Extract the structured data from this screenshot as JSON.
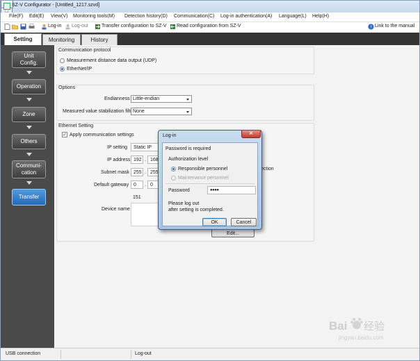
{
  "window": {
    "title": "SZ-V Configurator - [Untitled_1217.szvd]",
    "min": "—",
    "max": "□",
    "close": "✕"
  },
  "menu": [
    {
      "label": "File(F)"
    },
    {
      "label": "Edit(E)"
    },
    {
      "label": "View(V)"
    },
    {
      "label": "Monitoring tools(M)"
    },
    {
      "label": "Detection history(D)"
    },
    {
      "label": "Communication(C)"
    },
    {
      "label": "Log-in authentication(A)"
    },
    {
      "label": "Language(L)"
    },
    {
      "label": "Help(H)"
    }
  ],
  "toolbar": {
    "login": "Log-in",
    "logout": "Log-out",
    "transfer": "Transfer configuration to SZ-V",
    "read": "Read configuration from SZ-V",
    "manual": "Link to the manual"
  },
  "tabs": [
    {
      "label": "Setting"
    },
    {
      "label": "Monitoring"
    },
    {
      "label": "History"
    }
  ],
  "nav": [
    {
      "label": "Unit\nConfig."
    },
    {
      "label": "Operation"
    },
    {
      "label": "Zone"
    },
    {
      "label": "Others"
    },
    {
      "label": "Communi-\ncation"
    },
    {
      "label": "Transfer"
    }
  ],
  "comm_protocol": {
    "title": "Communication protocol",
    "opt_udp": "Measurement distance data output (UDP)",
    "opt_eip": "EtherNet/IP"
  },
  "options": {
    "title": "Options",
    "endianness_label": "Endianness",
    "endianness_value": "Little-endian",
    "stab_label": "Measured value stabilization filter",
    "stab_value": "None"
  },
  "ethernet": {
    "title": "Ethernet Setting",
    "apply_label": "Apply communication settings",
    "ip_setting_label": "IP setting",
    "ip_setting_value": "Static IP",
    "ip_address_label": "IP address",
    "ip_o1": "192",
    "ip_o2": "168",
    "subnet_label": "Subnet mask",
    "sub_o1": "255",
    "sub_o2": "255",
    "gateway_label": "Default gateway",
    "gw_o1": "0",
    "gw_o2": "0",
    "dot": ".",
    "extra_number": "151",
    "right_partial": "ection",
    "device_name_label": "Device name",
    "edit_button": "Edit..."
  },
  "dialog": {
    "title": "Log-in",
    "close": "✕",
    "pw_required": "Password is required",
    "auth_level": "Authorization level",
    "responsible": "Responsible personnel",
    "maintenance": "Maintenance personnel",
    "password_label": "Password",
    "password_value": "●●●●",
    "note_line1": "Please log out",
    "note_line2": "after setting is completed.",
    "ok": "OK",
    "cancel": "Cancel"
  },
  "statusbar": {
    "connection": "USB connection",
    "login_state": "Log-out"
  },
  "watermark": {
    "brand": "Bai",
    "brand_cn": "经验",
    "url": "jingyan.baidu.com"
  },
  "colors": {
    "nav_active": "#2f7fd1",
    "tabbar": "#343434",
    "nav_bg": "#4a4a4a"
  }
}
